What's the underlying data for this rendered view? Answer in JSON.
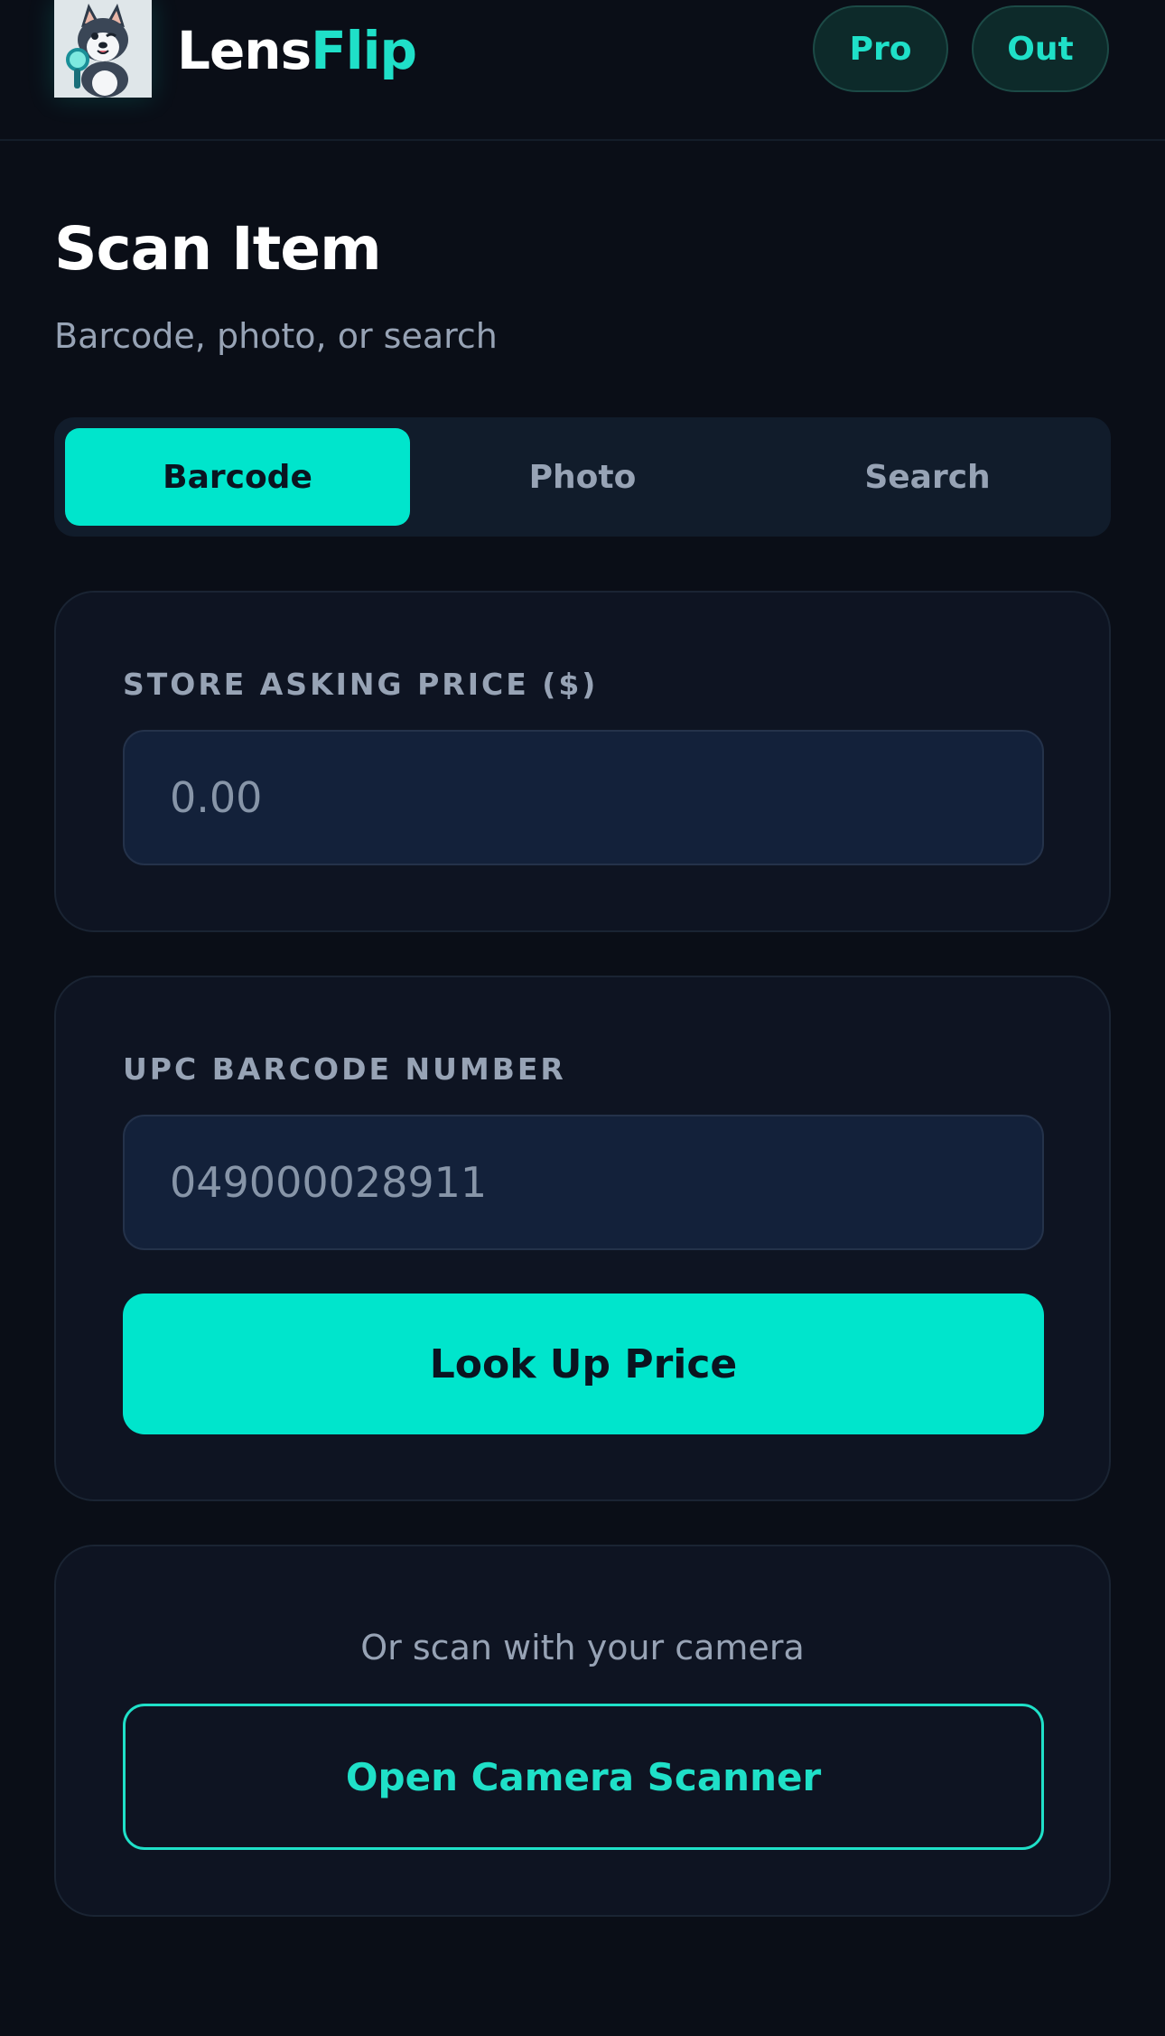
{
  "header": {
    "brand_part1": "Lens",
    "brand_part2": "Flip",
    "pro_label": "Pro",
    "out_label": "Out",
    "logo_icon": "husky-magnifier-logo"
  },
  "page": {
    "title": "Scan Item",
    "subtitle": "Barcode, photo, or search"
  },
  "tabs": [
    {
      "label": "Barcode",
      "active": true
    },
    {
      "label": "Photo",
      "active": false
    },
    {
      "label": "Search",
      "active": false
    }
  ],
  "price_card": {
    "label": "STORE ASKING PRICE ($)",
    "placeholder": "0.00"
  },
  "upc_card": {
    "label": "UPC BARCODE NUMBER",
    "placeholder": "049000028911",
    "button_label": "Look Up Price"
  },
  "camera_card": {
    "hint": "Or scan with your camera",
    "button_label": "Open Camera Scanner"
  },
  "colors": {
    "accent": "#00e5cc",
    "background": "#0a0e17",
    "card": "#0e1422",
    "muted_text": "#97a3b5"
  }
}
